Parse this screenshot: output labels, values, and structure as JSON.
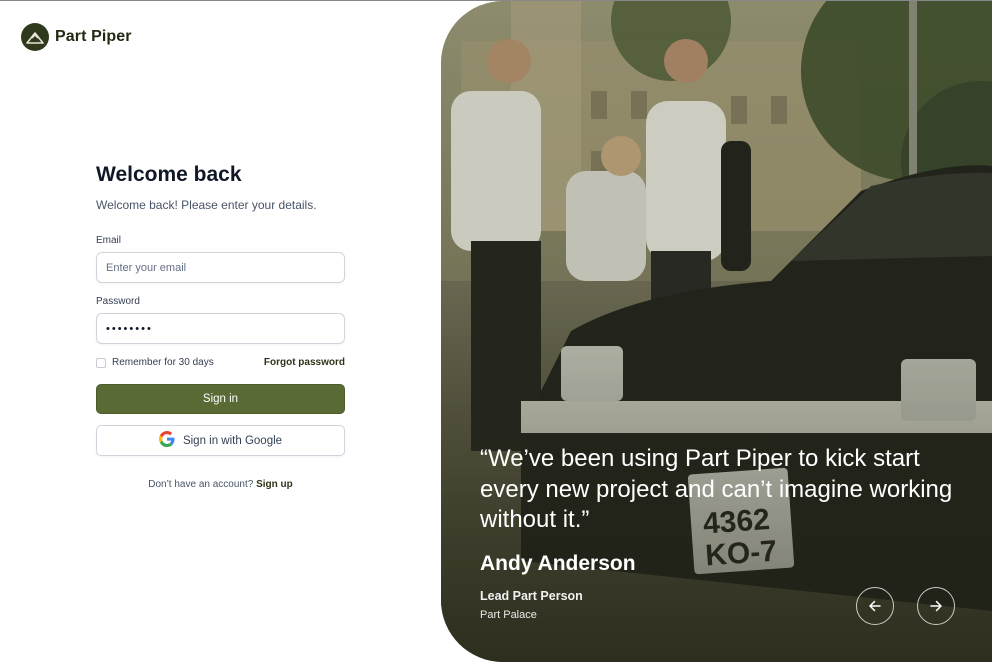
{
  "brand": {
    "name": "Part Piper"
  },
  "login": {
    "title": "Welcome back",
    "subtitle": "Welcome back! Please enter your details.",
    "email_label": "Email",
    "email_placeholder": "Enter your email",
    "password_label": "Password",
    "password_value": "••••••••",
    "remember_label": "Remember for 30 days",
    "forgot_label": "Forgot password",
    "signin_label": "Sign in",
    "google_label": "Sign in with Google",
    "signup_prompt": "Don’t have an account?",
    "signup_link": "Sign up"
  },
  "testimonial": {
    "quote": "“We’ve been using Part Piper to kick start every new project and can’t imagine working without it.”",
    "author": "Andy Anderson",
    "role": "Lead Part Person",
    "company": "Part Palace"
  },
  "icons": {
    "prev": "arrow-left-icon",
    "next": "arrow-right-icon",
    "google": "google-g-icon",
    "logo": "mountain-logo-icon"
  },
  "colors": {
    "brand_dark": "#2f3a1c",
    "primary_button": "#5a6a35",
    "text": "#101828"
  }
}
